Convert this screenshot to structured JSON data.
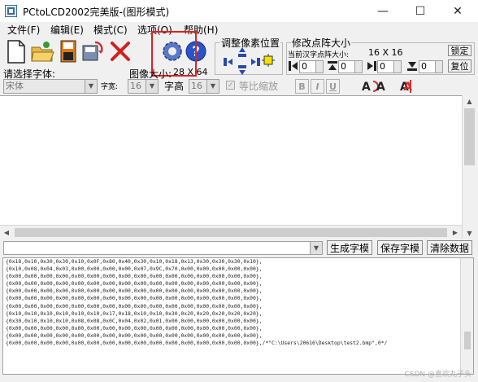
{
  "window": {
    "title": "PCtoLCD2002完美版-(图形模式)",
    "minimize": "—",
    "maximize": "☐",
    "close": "✕"
  },
  "menu": {
    "items": [
      {
        "label": "文件(F)"
      },
      {
        "label": "编辑(E)"
      },
      {
        "label": "模式(C)"
      },
      {
        "label": "选项(O)"
      },
      {
        "label": "帮助(H)"
      }
    ]
  },
  "adjust_group": {
    "label": "调整像素位置"
  },
  "resize_group": {
    "label": "修改点阵大小",
    "current_label": "当前汉字点阵大小:",
    "current_size": "16 X 16",
    "lock_button": "锁定",
    "reset_button": "复位",
    "spinners": [
      "0",
      "0",
      "0",
      "0"
    ]
  },
  "font": {
    "label": "请选择字体:",
    "value": "宋体",
    "width_label": "字宽:",
    "width_value": "16",
    "height_label": "字高",
    "height_value": "16",
    "scale_label": "等比缩放"
  },
  "image_size": {
    "label": "图像大小:",
    "value": "28 X 64"
  },
  "format": {
    "bold": "B",
    "italic": "I",
    "underline": "U"
  },
  "input": {
    "value": ""
  },
  "buttons": {
    "generate": "生成字模",
    "save": "保存字模",
    "clear": "清除数据"
  },
  "output_lines": [
    "{0x18,0x10,0x30,0x30,0x10,0x0F,0x80,0x40,0x30,0x10,0x18,0x13,0x30,0x30,0x30,0x10},",
    "{0x10,0x08,0x04,0x03,0x00,0x00,0x00,0x00,0x07,0x9C,0x70,0x00,0x00,0x00,0x00,0x00},",
    "{0x00,0x00,0x00,0x00,0x00,0x00,0x00,0x00,0x00,0x00,0x00,0x00,0x00,0x00,0x00,0x00},",
    "{0x00,0x00,0x00,0x00,0x00,0x00,0x00,0x00,0x00,0x00,0x00,0x00,0x00,0x00,0x00,0x00},",
    "{0x00,0x00,0x00,0x00,0x00,0x00,0x00,0x00,0x00,0x00,0x00,0x00,0x00,0x00,0x00,0x00},",
    "{0x00,0x00,0x00,0x00,0x00,0x00,0x00,0x00,0x00,0x00,0x00,0x00,0x00,0x00,0x00,0x00},",
    "{0x00,0x00,0x00,0x00,0x00,0x00,0x00,0x00,0x00,0x00,0x00,0x00,0x00,0x00,0x00,0x00},",
    "{0x10,0x10,0x10,0x10,0x10,0x10,0x17,0x18,0x10,0x10,0x30,0x20,0x20,0x20,0x20,0x20},",
    "{0x30,0x10,0x10,0x10,0x08,0x08,0x0C,0x04,0x02,0x01,0x00,0x00,0x00,0x00,0x00,0x00},",
    "{0x00,0x00,0x00,0x00,0x00,0x00,0x00,0x00,0x00,0x00,0x00,0x00,0x00,0x00,0x00,0x00},",
    "{0x00,0x00,0x00,0x00,0x00,0x00,0x00,0x00,0x00,0x00,0x00,0x00,0x00,0x00,0x00,0x00},",
    "{0x00,0x00,0x00,0x00,0x00,0x00,0x00,0x00,0x00,0x00,0x00,0x00,0x00,0x00,0x00,0x00},/*\"C:\\Users\\20616\\Desktop\\test2.bmp\",0*/"
  ],
  "watermark": "CSDN @喜欢丸子头"
}
